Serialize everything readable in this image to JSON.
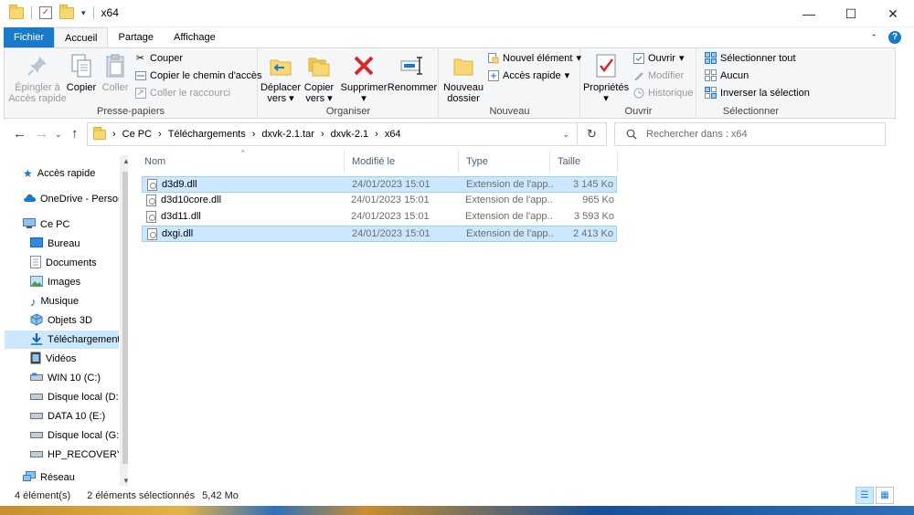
{
  "window": {
    "title": "x64",
    "minimize": "—",
    "maximize": "☐",
    "close": "✕"
  },
  "tabs": {
    "file": "Fichier",
    "home": "Accueil",
    "share": "Partage",
    "view": "Affichage"
  },
  "ribbon": {
    "clipboard": {
      "label": "Presse-papiers",
      "pin": "Épingler à Accès rapide",
      "pin_line1": "Épingler à",
      "pin_line2": "Accès rapide",
      "copy": "Copier",
      "paste": "Coller",
      "cut": "Couper",
      "copy_path": "Copier le chemin d'accès",
      "paste_shortcut": "Coller le raccourci"
    },
    "organize": {
      "label": "Organiser",
      "move_line1": "Déplacer",
      "move_line2": "vers",
      "copy_line1": "Copier",
      "copy_line2": "vers",
      "delete": "Supprimer",
      "rename": "Renommer"
    },
    "new": {
      "label": "Nouveau",
      "new_folder_line1": "Nouveau",
      "new_folder_line2": "dossier",
      "new_item": "Nouvel élément",
      "quick_access": "Accès rapide"
    },
    "open": {
      "label": "Ouvrir",
      "properties": "Propriétés",
      "open": "Ouvrir",
      "edit": "Modifier",
      "history": "Historique"
    },
    "select": {
      "label": "Sélectionner",
      "select_all": "Sélectionner tout",
      "select_none": "Aucun",
      "invert": "Inverser la sélection"
    }
  },
  "address": {
    "crumbs": [
      "Ce PC",
      "Téléchargements",
      "dxvk-2.1.tar",
      "dxvk-2.1",
      "x64"
    ],
    "search_placeholder": "Rechercher dans : x64"
  },
  "nav": {
    "items": [
      {
        "label": "Accès rapide",
        "icon": "star-icon"
      },
      {
        "label": "OneDrive - Person",
        "icon": "cloud-icon"
      },
      {
        "label": "Ce PC",
        "icon": "computer-icon"
      },
      {
        "label": "Bureau",
        "icon": "desktop-icon"
      },
      {
        "label": "Documents",
        "icon": "documents-icon"
      },
      {
        "label": "Images",
        "icon": "images-icon"
      },
      {
        "label": "Musique",
        "icon": "music-icon"
      },
      {
        "label": "Objets 3D",
        "icon": "3d-objects-icon"
      },
      {
        "label": "Téléchargements",
        "icon": "downloads-icon"
      },
      {
        "label": "Vidéos",
        "icon": "videos-icon"
      },
      {
        "label": "WIN 10 (C:)",
        "icon": "drive-icon"
      },
      {
        "label": "Disque local (D:)",
        "icon": "drive-icon"
      },
      {
        "label": "DATA 10 (E:)",
        "icon": "drive-icon"
      },
      {
        "label": "Disque local (G:)",
        "icon": "drive-icon"
      },
      {
        "label": "HP_RECOVERY (",
        "icon": "drive-icon"
      },
      {
        "label": "Réseau",
        "icon": "network-icon"
      }
    ]
  },
  "columns": {
    "name": "Nom",
    "modified": "Modifié le",
    "type": "Type",
    "size": "Taille"
  },
  "files": [
    {
      "name": "d3d9.dll",
      "modified": "24/01/2023 15:01",
      "type": "Extension de l'app...",
      "size": "3 145 Ko",
      "selected": true
    },
    {
      "name": "d3d10core.dll",
      "modified": "24/01/2023 15:01",
      "type": "Extension de l'app...",
      "size": "965 Ko",
      "selected": false
    },
    {
      "name": "d3d11.dll",
      "modified": "24/01/2023 15:01",
      "type": "Extension de l'app...",
      "size": "3 593 Ko",
      "selected": false
    },
    {
      "name": "dxgi.dll",
      "modified": "24/01/2023 15:01",
      "type": "Extension de l'app...",
      "size": "2 413 Ko",
      "selected": true
    }
  ],
  "status": {
    "count": "4 élément(s)",
    "selection": "2 éléments sélectionnés",
    "size": "5,42 Mo"
  },
  "colors": {
    "accent": "#1979ca",
    "selection": "#cce8ff",
    "folder": "#f8d775"
  }
}
